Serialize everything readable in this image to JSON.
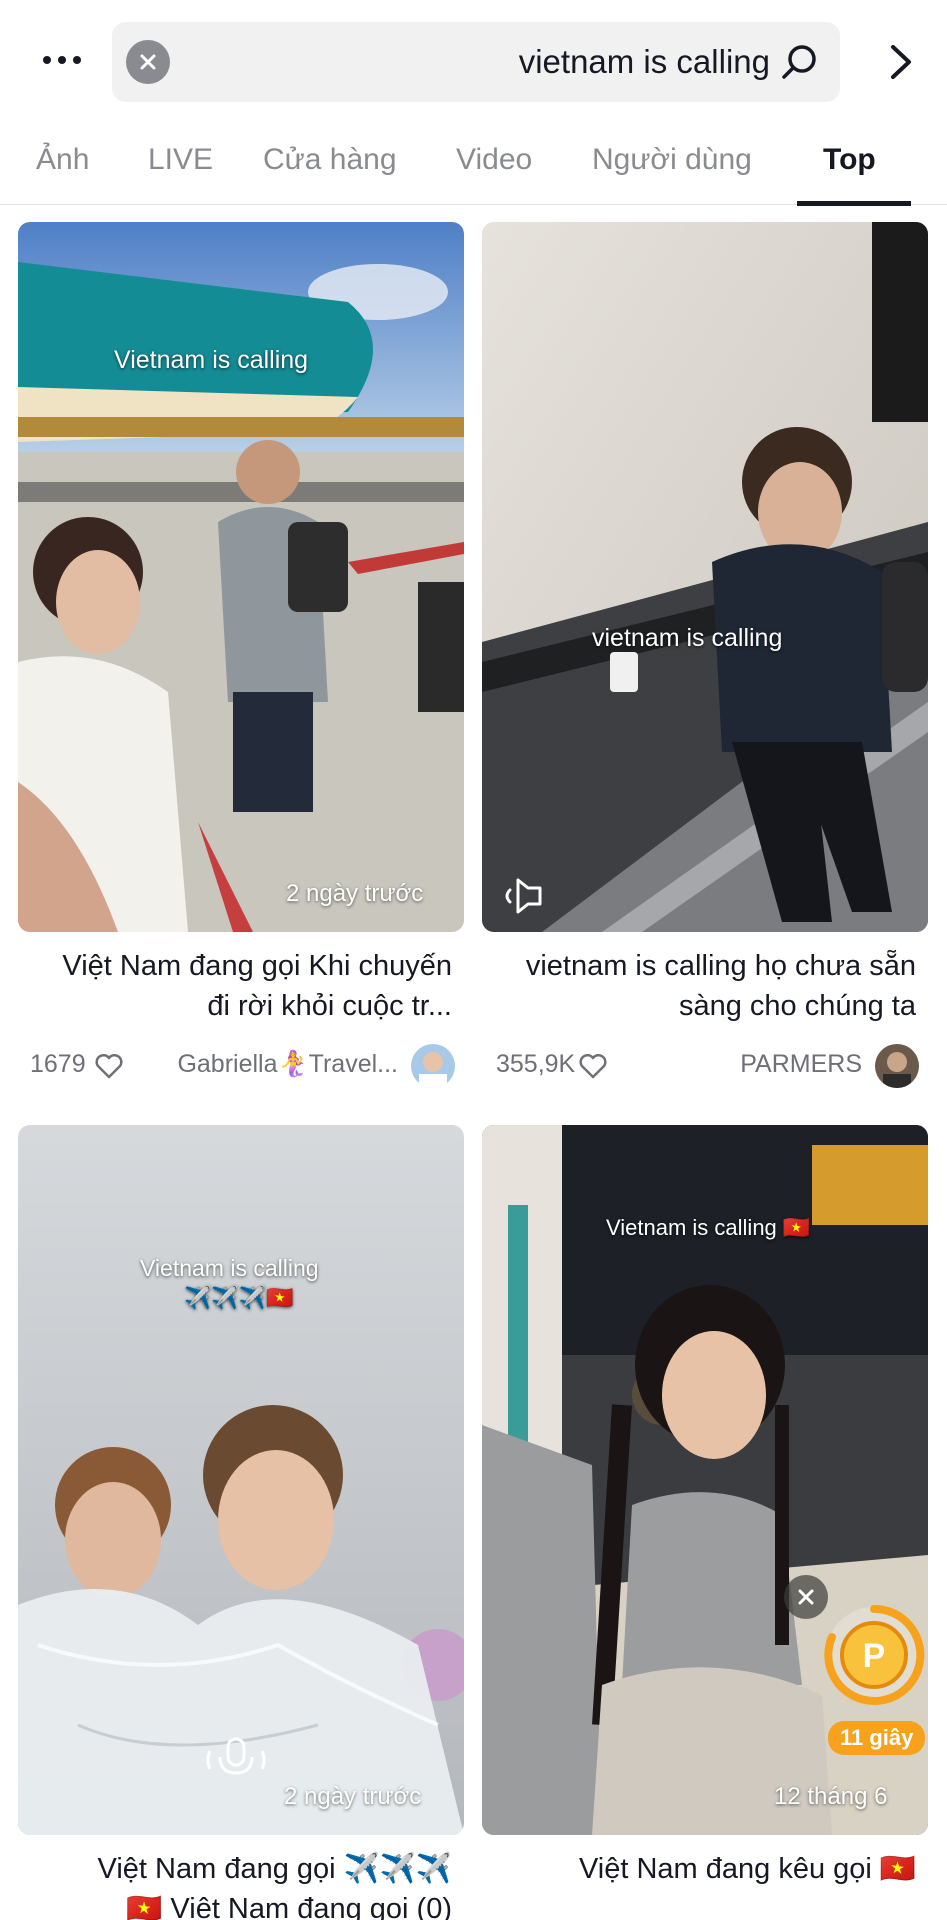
{
  "search": {
    "query": "vietnam is calling"
  },
  "tabs": [
    {
      "label": "Top",
      "active": true
    },
    {
      "label": "Người dùng",
      "active": false
    },
    {
      "label": "Video",
      "active": false
    },
    {
      "label": "Cửa hàng",
      "active": false
    },
    {
      "label": "LIVE",
      "active": false
    },
    {
      "label": "Ảnh",
      "active": false
    }
  ],
  "cards": [
    {
      "overlay_text": "vietnam is calling",
      "title": "vietnam is calling họ chưa sẵn sàng cho chúng ta",
      "author": "PARMERS",
      "likes": "355,9K",
      "icon": "speaker-muted-icon"
    },
    {
      "overlay_text": "Vietnam is calling",
      "time": "2 ngày trước",
      "title": "Việt Nam đang gọi Khi chuyến đi rời khỏi cuộc tr...",
      "author": "Gabriella🧜‍♀️Travel...",
      "likes": "1679"
    },
    {
      "overlay_text": "Vietnam is calling 🇻🇳",
      "time": "12 tháng 6",
      "title": "Việt Nam đang kêu gọi 🇻🇳",
      "timer_badge": "11 giây",
      "coin_letter": "P"
    },
    {
      "overlay_text": "Vietnam is calling",
      "overlay_text2": "✈️✈️✈️🇻🇳",
      "time": "2 ngày trước",
      "title": "Việt Nam đang gọi ✈️✈️✈️",
      "title2": "🇻🇳 Việt Nam đang gọi (0)"
    }
  ],
  "colors": {
    "accent_orange": "#f6a21c",
    "text_primary": "#161823",
    "text_secondary": "#8a8b91"
  }
}
